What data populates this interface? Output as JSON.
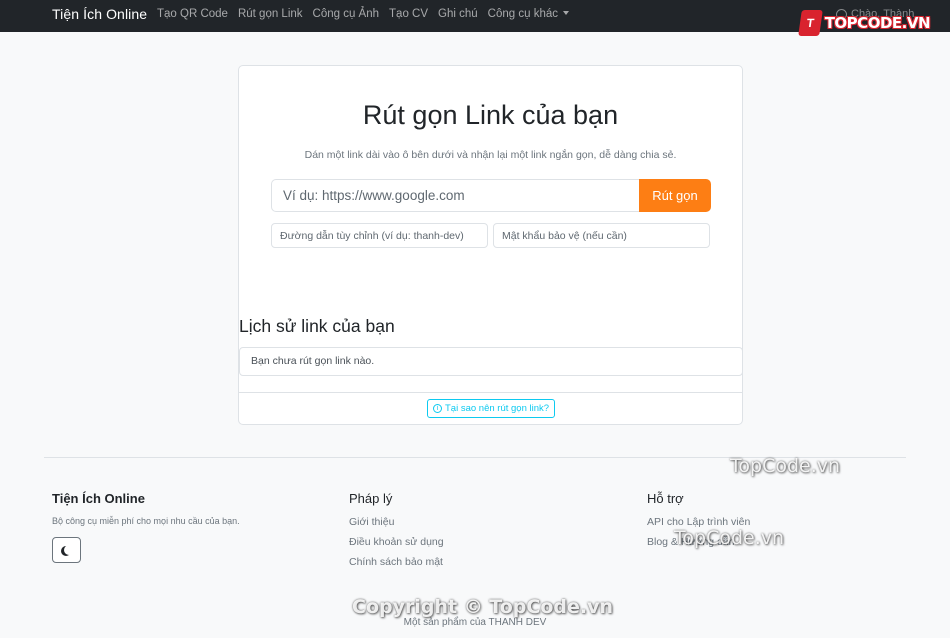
{
  "navbar": {
    "brand": "Tiện Ích Online",
    "links": [
      "Tạo QR Code",
      "Rút gọn Link",
      "Công cụ Ảnh",
      "Tạo CV",
      "Ghi chú",
      "Công cụ khác"
    ],
    "user_label": "Chào, Thành",
    "logo_mark": "T",
    "logo_text": "TOPCODE.VN"
  },
  "main": {
    "title": "Rút gọn Link của bạn",
    "subtitle": "Dán một link dài vào ô bên dưới và nhận lại một link ngắn gọn, dễ dàng chia sẻ.",
    "url_placeholder": "Ví dụ: https://www.google.com",
    "shorten_label": "Rút gọn",
    "slug_placeholder": "Đường dẫn tùy chỉnh (ví dụ: thanh-dev)",
    "password_placeholder": "Mật khẩu bảo vệ (nếu cần)",
    "history_title": "Lịch sử link của bạn",
    "history_empty": "Bạn chưa rút gọn link nào.",
    "why_label": "Tại sao nên rút gọn link?"
  },
  "footer": {
    "brand_title": "Tiện Ích Online",
    "brand_desc": "Bộ công cụ miễn phí cho mọi nhu cầu của bạn.",
    "legal_title": "Pháp lý",
    "legal_links": [
      "Giới thiệu",
      "Điều khoản sử dụng",
      "Chính sách bảo mật"
    ],
    "support_title": "Hỗ trợ",
    "support_links": [
      "API cho Lập trình viên",
      "Blog & Hướng dẫn"
    ],
    "copyright": "Một sản phẩm của THANH DEV"
  },
  "watermarks": [
    "TopCode.vn",
    "TopCode.vn",
    "Copyright © TopCode.vn"
  ],
  "colors": {
    "navbar_bg": "#212529",
    "accent": "#fd7e14",
    "info": "#0dcaf0"
  }
}
